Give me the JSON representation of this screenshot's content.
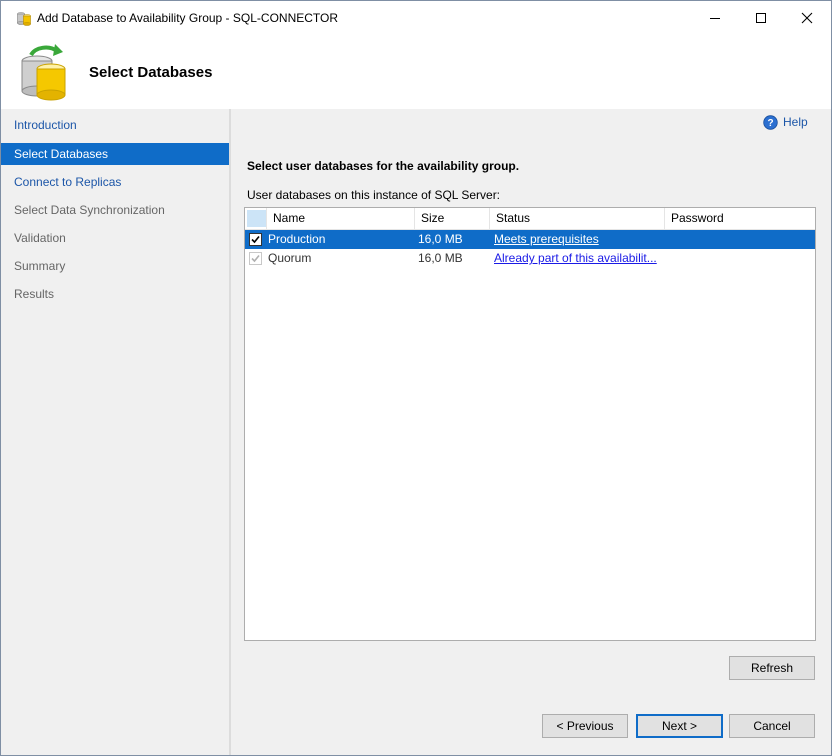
{
  "window": {
    "title": "Add Database to Availability Group - SQL-CONNECTOR",
    "icons": {
      "app": "database-app-icon",
      "minimize": "minimize-icon",
      "maximize": "maximize-icon",
      "close": "close-icon"
    }
  },
  "banner": {
    "title": "Select Databases",
    "icon": "database-sync-icon"
  },
  "sidebar": {
    "items": [
      {
        "label": "Introduction",
        "state": "link"
      },
      {
        "label": "Select Databases",
        "state": "active"
      },
      {
        "label": "Connect to Replicas",
        "state": "link"
      },
      {
        "label": "Select Data Synchronization",
        "state": "disabled"
      },
      {
        "label": "Validation",
        "state": "disabled"
      },
      {
        "label": "Summary",
        "state": "disabled"
      },
      {
        "label": "Results",
        "state": "disabled"
      }
    ]
  },
  "help": {
    "label": "Help",
    "icon": "help-icon"
  },
  "main": {
    "instruction": "Select user databases for the availability group.",
    "db_list_label": "User databases on this instance of SQL Server:"
  },
  "grid": {
    "columns": [
      "Name",
      "Size",
      "Status",
      "Password"
    ],
    "rows": [
      {
        "checked": true,
        "enabled": true,
        "selected": true,
        "name": "Production",
        "size": "16,0 MB",
        "status": "Meets prerequisites",
        "password": ""
      },
      {
        "checked": true,
        "enabled": false,
        "selected": false,
        "name": "Quorum",
        "size": "16,0 MB",
        "status": "Already part of this availabilit...",
        "password": ""
      }
    ]
  },
  "buttons": {
    "refresh": "Refresh",
    "previous": "< Previous",
    "next": "Next >",
    "cancel": "Cancel"
  },
  "colors": {
    "accent": "#0f6cc8",
    "link": "#1c56a8",
    "panel": "#f0f0f0"
  }
}
